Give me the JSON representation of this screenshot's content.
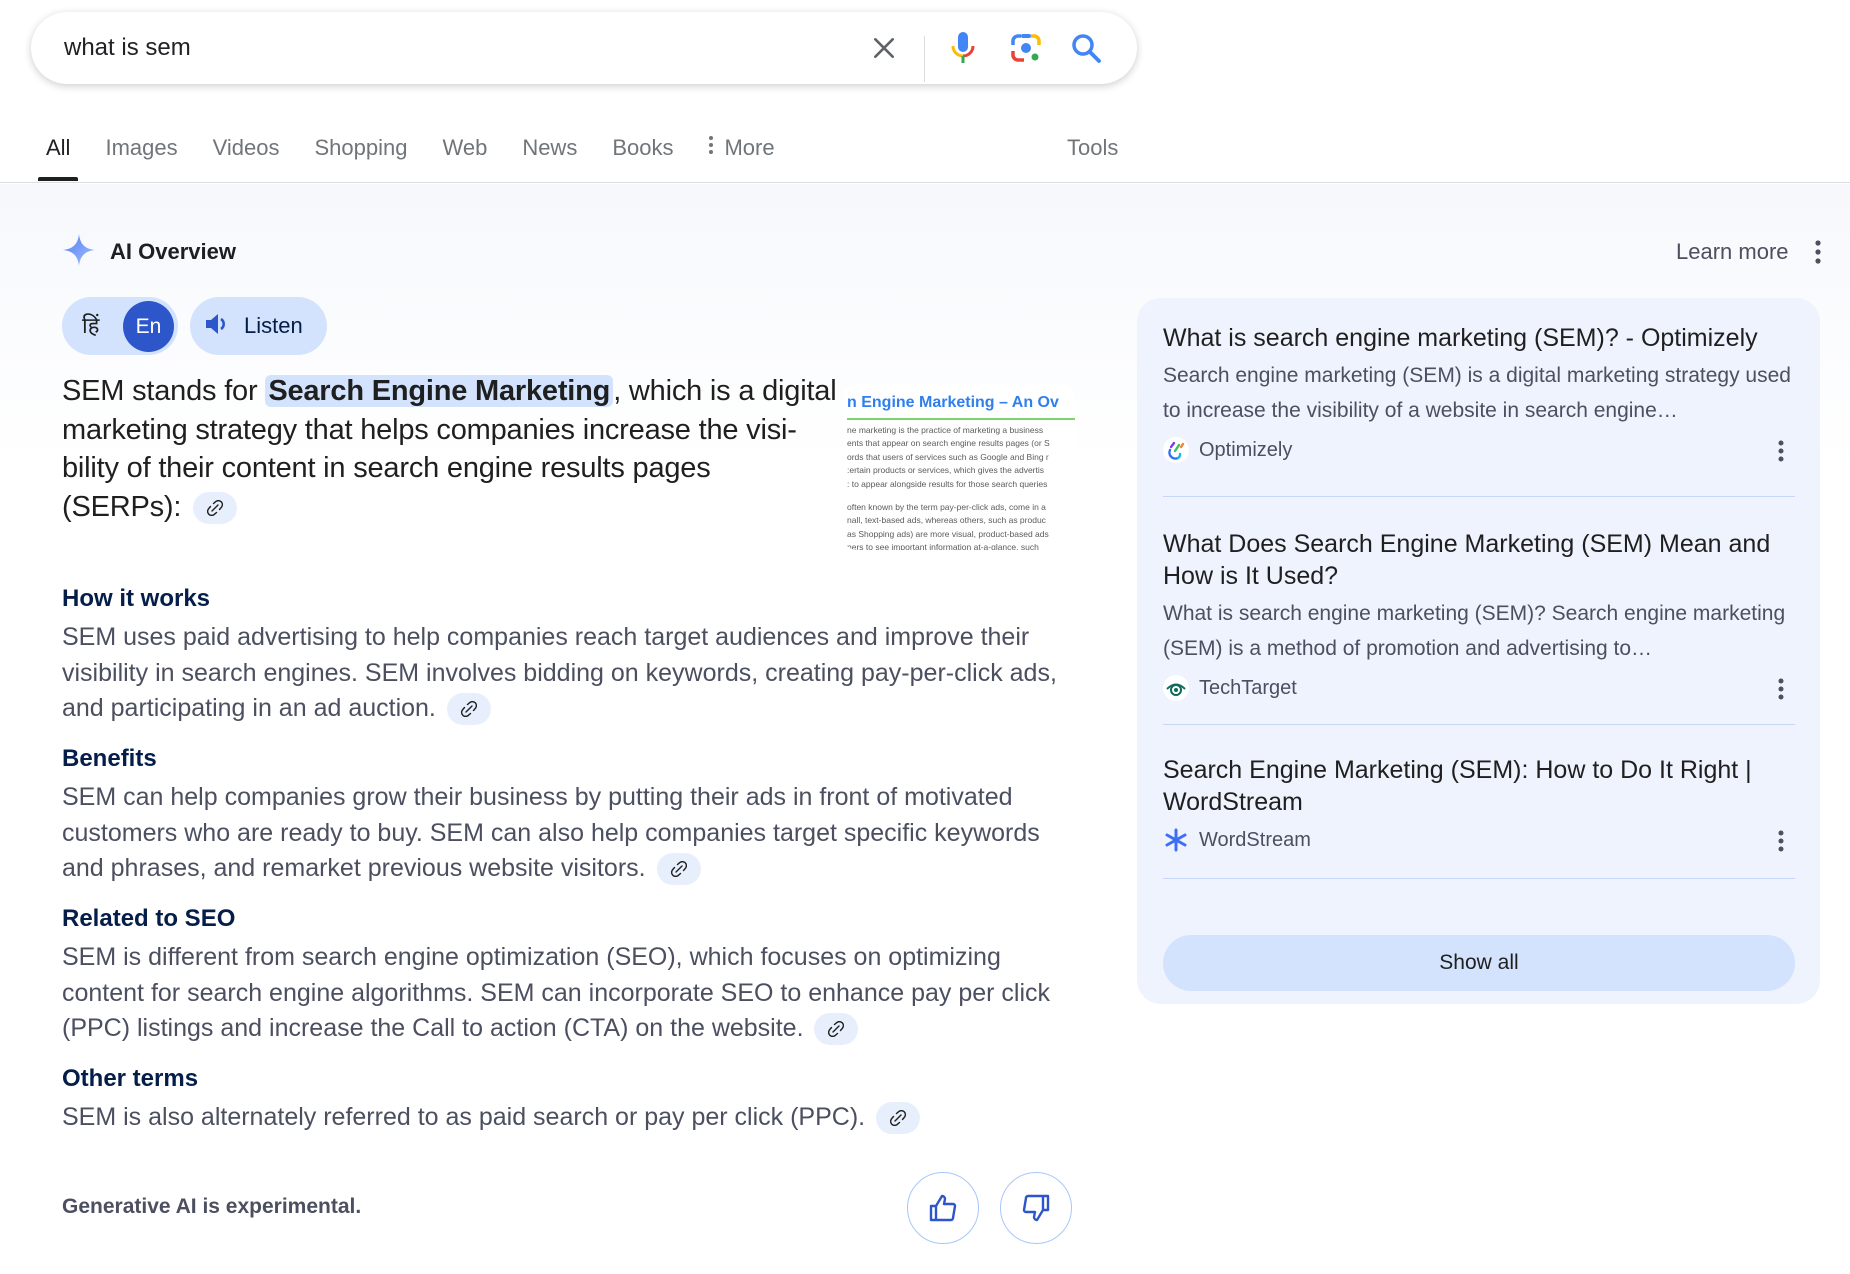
{
  "search": {
    "query": "what is sem",
    "icons": [
      "close-icon",
      "microphone-icon",
      "lens-camera-icon",
      "search-icon"
    ]
  },
  "tabs": [
    {
      "label": "All",
      "active": true
    },
    {
      "label": "Images"
    },
    {
      "label": "Videos"
    },
    {
      "label": "Shopping"
    },
    {
      "label": "Web"
    },
    {
      "label": "News"
    },
    {
      "label": "Books"
    },
    {
      "label": "More",
      "icon": "more-vert-icon"
    }
  ],
  "tools_label": "Tools",
  "ai_overview": {
    "title": "AI Overview",
    "learn_more": "Learn more",
    "lang_hindi": "हिं",
    "lang_english": "En",
    "listen_label": "Listen",
    "lead": {
      "before": "SEM stands for ",
      "highlight": "Search Engine Marketing",
      "after": ", which is a digital marketing strategy that helps companies increase the visi­bility of their content in search engine results pages (SERPs):"
    },
    "thumbnail": {
      "title": "n Engine Marketing – An Ov",
      "lines": [
        "ne marketing is the practice of marketing a business",
        "ents that appear on search engine results pages (or S",
        "ords that users of services such as Google and Bing r",
        ":ertain products or services, which gives the advertis",
        ": to appear alongside results for those search queries",
        "",
        "often known by the term pay-per-click ads, come in a",
        "nall, text-based ads, whereas others, such as produc",
        "as Shopping ads) are more visual, product-based ads",
        "ners to see important information at-a-glance, such"
      ]
    },
    "sections": [
      {
        "heading": "How it works",
        "text": "SEM uses paid advertising to help companies reach target audiences and improve their visibility in search engines. SEM involves bidding on keywords, creating pay-per-click ads, and participating in an ad auction."
      },
      {
        "heading": "Benefits",
        "text": "SEM can help companies grow their business by putting their ads in front of motivated customers who are ready to buy. SEM can also help companies target specific keywords and phrases, and remarket previous website visitors."
      },
      {
        "heading": "Related to SEO",
        "text": "SEM is different from search engine optimization (SEO), which focuses on optimizing content for search engine algorithms. SEM can incorporate SEO to enhance pay per click (PPC) listings and increase the Call to action (CTA) on the website."
      },
      {
        "heading": "Other terms",
        "text": "SEM is also alternately referred to as paid search or pay per click (PPC)."
      }
    ],
    "footer_note": "Generative AI is experimental."
  },
  "sources": {
    "items": [
      {
        "title": "What is search engine marketing (SEM)? - Optimizely",
        "snippet": "Search engine marketing (SEM) is a digital marketing strategy used to increase the visibility of a website in search engine…",
        "site": "Optimizely"
      },
      {
        "title": "What Does Search Engine Marketing (SEM) Mean and How is It Used?",
        "snippet": "What is search engine marketing (SEM)? Search engine marketing (SEM) is a method of promotion and advertising to…",
        "site": "TechTarget"
      },
      {
        "title": "Search Engine Marketing (SEM): How to Do It Right | WordStream",
        "snippet": "",
        "site": "WordStream"
      }
    ],
    "show_all": "Show all"
  },
  "colors": {
    "accent_blue": "#2c56c9",
    "chip_bg": "#d3e3fd",
    "card_bg": "#eff3fe",
    "body_text": "#4c4f60",
    "heading_text": "#041e49"
  }
}
